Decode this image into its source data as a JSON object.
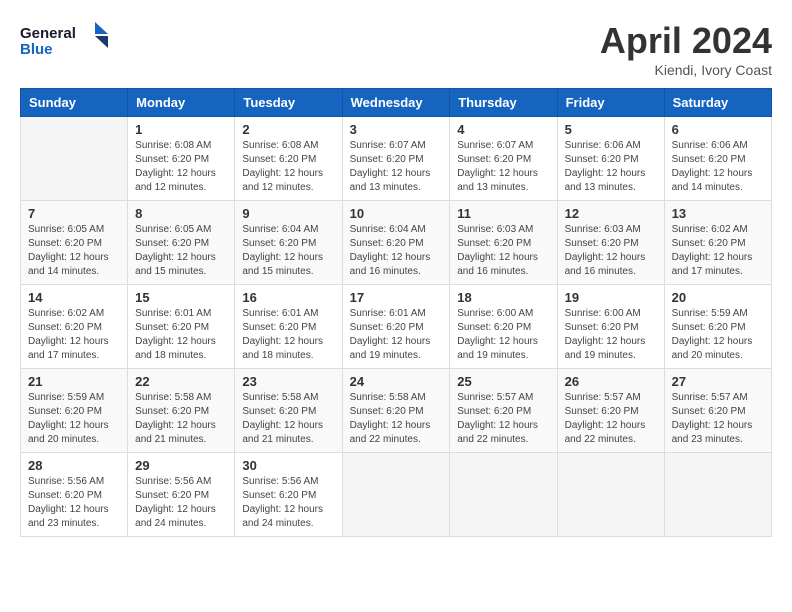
{
  "header": {
    "logo_line1": "General",
    "logo_line2": "Blue",
    "month": "April 2024",
    "location": "Kiendi, Ivory Coast"
  },
  "weekdays": [
    "Sunday",
    "Monday",
    "Tuesday",
    "Wednesday",
    "Thursday",
    "Friday",
    "Saturday"
  ],
  "weeks": [
    [
      {
        "day": "",
        "sunrise": "",
        "sunset": "",
        "daylight": ""
      },
      {
        "day": "1",
        "sunrise": "Sunrise: 6:08 AM",
        "sunset": "Sunset: 6:20 PM",
        "daylight": "Daylight: 12 hours and 12 minutes."
      },
      {
        "day": "2",
        "sunrise": "Sunrise: 6:08 AM",
        "sunset": "Sunset: 6:20 PM",
        "daylight": "Daylight: 12 hours and 12 minutes."
      },
      {
        "day": "3",
        "sunrise": "Sunrise: 6:07 AM",
        "sunset": "Sunset: 6:20 PM",
        "daylight": "Daylight: 12 hours and 13 minutes."
      },
      {
        "day": "4",
        "sunrise": "Sunrise: 6:07 AM",
        "sunset": "Sunset: 6:20 PM",
        "daylight": "Daylight: 12 hours and 13 minutes."
      },
      {
        "day": "5",
        "sunrise": "Sunrise: 6:06 AM",
        "sunset": "Sunset: 6:20 PM",
        "daylight": "Daylight: 12 hours and 13 minutes."
      },
      {
        "day": "6",
        "sunrise": "Sunrise: 6:06 AM",
        "sunset": "Sunset: 6:20 PM",
        "daylight": "Daylight: 12 hours and 14 minutes."
      }
    ],
    [
      {
        "day": "7",
        "sunrise": "Sunrise: 6:05 AM",
        "sunset": "Sunset: 6:20 PM",
        "daylight": "Daylight: 12 hours and 14 minutes."
      },
      {
        "day": "8",
        "sunrise": "Sunrise: 6:05 AM",
        "sunset": "Sunset: 6:20 PM",
        "daylight": "Daylight: 12 hours and 15 minutes."
      },
      {
        "day": "9",
        "sunrise": "Sunrise: 6:04 AM",
        "sunset": "Sunset: 6:20 PM",
        "daylight": "Daylight: 12 hours and 15 minutes."
      },
      {
        "day": "10",
        "sunrise": "Sunrise: 6:04 AM",
        "sunset": "Sunset: 6:20 PM",
        "daylight": "Daylight: 12 hours and 16 minutes."
      },
      {
        "day": "11",
        "sunrise": "Sunrise: 6:03 AM",
        "sunset": "Sunset: 6:20 PM",
        "daylight": "Daylight: 12 hours and 16 minutes."
      },
      {
        "day": "12",
        "sunrise": "Sunrise: 6:03 AM",
        "sunset": "Sunset: 6:20 PM",
        "daylight": "Daylight: 12 hours and 16 minutes."
      },
      {
        "day": "13",
        "sunrise": "Sunrise: 6:02 AM",
        "sunset": "Sunset: 6:20 PM",
        "daylight": "Daylight: 12 hours and 17 minutes."
      }
    ],
    [
      {
        "day": "14",
        "sunrise": "Sunrise: 6:02 AM",
        "sunset": "Sunset: 6:20 PM",
        "daylight": "Daylight: 12 hours and 17 minutes."
      },
      {
        "day": "15",
        "sunrise": "Sunrise: 6:01 AM",
        "sunset": "Sunset: 6:20 PM",
        "daylight": "Daylight: 12 hours and 18 minutes."
      },
      {
        "day": "16",
        "sunrise": "Sunrise: 6:01 AM",
        "sunset": "Sunset: 6:20 PM",
        "daylight": "Daylight: 12 hours and 18 minutes."
      },
      {
        "day": "17",
        "sunrise": "Sunrise: 6:01 AM",
        "sunset": "Sunset: 6:20 PM",
        "daylight": "Daylight: 12 hours and 19 minutes."
      },
      {
        "day": "18",
        "sunrise": "Sunrise: 6:00 AM",
        "sunset": "Sunset: 6:20 PM",
        "daylight": "Daylight: 12 hours and 19 minutes."
      },
      {
        "day": "19",
        "sunrise": "Sunrise: 6:00 AM",
        "sunset": "Sunset: 6:20 PM",
        "daylight": "Daylight: 12 hours and 19 minutes."
      },
      {
        "day": "20",
        "sunrise": "Sunrise: 5:59 AM",
        "sunset": "Sunset: 6:20 PM",
        "daylight": "Daylight: 12 hours and 20 minutes."
      }
    ],
    [
      {
        "day": "21",
        "sunrise": "Sunrise: 5:59 AM",
        "sunset": "Sunset: 6:20 PM",
        "daylight": "Daylight: 12 hours and 20 minutes."
      },
      {
        "day": "22",
        "sunrise": "Sunrise: 5:58 AM",
        "sunset": "Sunset: 6:20 PM",
        "daylight": "Daylight: 12 hours and 21 minutes."
      },
      {
        "day": "23",
        "sunrise": "Sunrise: 5:58 AM",
        "sunset": "Sunset: 6:20 PM",
        "daylight": "Daylight: 12 hours and 21 minutes."
      },
      {
        "day": "24",
        "sunrise": "Sunrise: 5:58 AM",
        "sunset": "Sunset: 6:20 PM",
        "daylight": "Daylight: 12 hours and 22 minutes."
      },
      {
        "day": "25",
        "sunrise": "Sunrise: 5:57 AM",
        "sunset": "Sunset: 6:20 PM",
        "daylight": "Daylight: 12 hours and 22 minutes."
      },
      {
        "day": "26",
        "sunrise": "Sunrise: 5:57 AM",
        "sunset": "Sunset: 6:20 PM",
        "daylight": "Daylight: 12 hours and 22 minutes."
      },
      {
        "day": "27",
        "sunrise": "Sunrise: 5:57 AM",
        "sunset": "Sunset: 6:20 PM",
        "daylight": "Daylight: 12 hours and 23 minutes."
      }
    ],
    [
      {
        "day": "28",
        "sunrise": "Sunrise: 5:56 AM",
        "sunset": "Sunset: 6:20 PM",
        "daylight": "Daylight: 12 hours and 23 minutes."
      },
      {
        "day": "29",
        "sunrise": "Sunrise: 5:56 AM",
        "sunset": "Sunset: 6:20 PM",
        "daylight": "Daylight: 12 hours and 24 minutes."
      },
      {
        "day": "30",
        "sunrise": "Sunrise: 5:56 AM",
        "sunset": "Sunset: 6:20 PM",
        "daylight": "Daylight: 12 hours and 24 minutes."
      },
      {
        "day": "",
        "sunrise": "",
        "sunset": "",
        "daylight": ""
      },
      {
        "day": "",
        "sunrise": "",
        "sunset": "",
        "daylight": ""
      },
      {
        "day": "",
        "sunrise": "",
        "sunset": "",
        "daylight": ""
      },
      {
        "day": "",
        "sunrise": "",
        "sunset": "",
        "daylight": ""
      }
    ]
  ]
}
